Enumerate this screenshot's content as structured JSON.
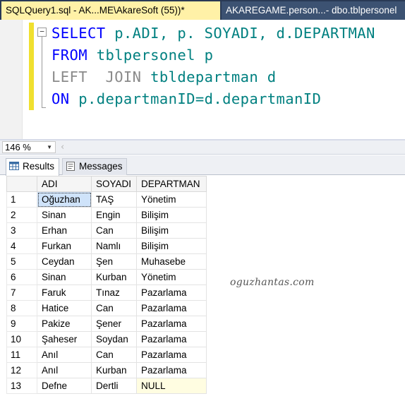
{
  "tabs": [
    {
      "label": "SQLQuery1.sql - AK...ME\\AkareSoft (55))*",
      "active": true
    },
    {
      "label": "AKAREGAME.person...- dbo.tblpersonel",
      "active": false
    }
  ],
  "query": {
    "line1": {
      "kw": "SELECT",
      "text": " p.ADI, p. SOYADI, d.DEPARTMAN"
    },
    "line2": {
      "kw": "FROM",
      "text": " tblpersonel p"
    },
    "line3": {
      "kw": "LEFT  JOIN",
      "text": " tbldepartman d"
    },
    "line4": {
      "kw": "ON",
      "text": " p.departmanID=d.departmanID"
    },
    "outline_symbol": "−"
  },
  "zoom": {
    "value": "146 %"
  },
  "result_tabs": {
    "results": "Results",
    "messages": "Messages"
  },
  "grid": {
    "columns": [
      "ADI",
      "SOYADI",
      "DEPARTMAN"
    ],
    "rows": [
      {
        "n": "1",
        "adi": "Oğuzhan",
        "soyadi": "TAŞ",
        "departman": "Yönetim"
      },
      {
        "n": "2",
        "adi": "Sinan",
        "soyadi": "Engin",
        "departman": "Bilişim"
      },
      {
        "n": "3",
        "adi": "Erhan",
        "soyadi": "Can",
        "departman": "Bilişim"
      },
      {
        "n": "4",
        "adi": "Furkan",
        "soyadi": "Namlı",
        "departman": "Bilişim"
      },
      {
        "n": "5",
        "adi": "Ceydan",
        "soyadi": "Şen",
        "departman": "Muhasebe"
      },
      {
        "n": "6",
        "adi": "Sinan",
        "soyadi": "Kurban",
        "departman": "Yönetim"
      },
      {
        "n": "7",
        "adi": "Faruk",
        "soyadi": "Tınaz",
        "departman": "Pazarlama"
      },
      {
        "n": "8",
        "adi": "Hatice",
        "soyadi": "Can",
        "departman": "Pazarlama"
      },
      {
        "n": "9",
        "adi": "Pakize",
        "soyadi": "Şener",
        "departman": "Pazarlama"
      },
      {
        "n": "10",
        "adi": "Şaheser",
        "soyadi": "Soydan",
        "departman": "Pazarlama"
      },
      {
        "n": "11",
        "adi": "Anıl",
        "soyadi": "Can",
        "departman": "Pazarlama"
      },
      {
        "n": "12",
        "adi": "Anıl",
        "soyadi": "Kurban",
        "departman": "Pazarlama"
      },
      {
        "n": "13",
        "adi": "Defne",
        "soyadi": "Dertli",
        "departman": "NULL"
      }
    ]
  },
  "watermark": "oguzhantas.com",
  "colors": {
    "keyword": "#0000ff",
    "identifier": "#008080",
    "active_tab": "#fff1a7",
    "tab_strip": "#293955"
  },
  "icons": {
    "results_tab": "grid-icon",
    "messages_tab": "messages-icon",
    "zoom_dropdown": "chevron-down-icon"
  }
}
